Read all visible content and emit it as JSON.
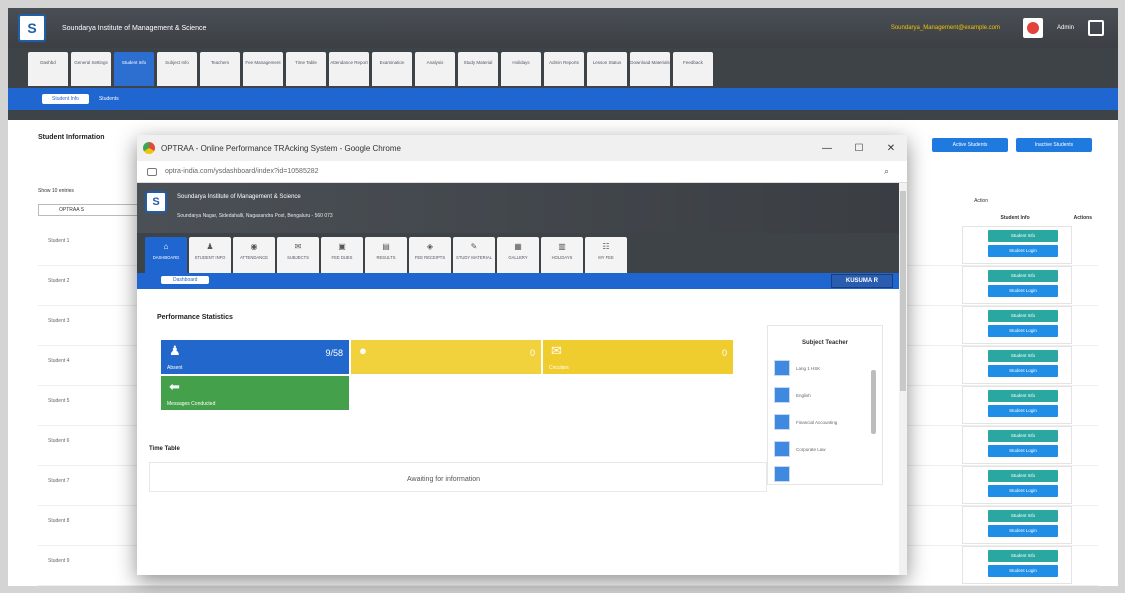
{
  "background_app": {
    "institution": "Soundarya Institute of Management & Science",
    "user_email": "Soundarya_Management@example.com",
    "user_name": "Admin",
    "tabs": [
      "Dashbd",
      "General Settings",
      "Student Info",
      "Subject Info",
      "Teachers",
      "Fee Management",
      "Time Table",
      "Attendance Report",
      "Examination",
      "Analysis",
      "Study Material",
      "Holidays",
      "Admin Reports",
      "Lesson Status",
      "Download Materials",
      "Feedback"
    ],
    "active_tab_index": 2,
    "subnav": {
      "pill": "Student Info",
      "link": "Students"
    },
    "section_title": "Student Information",
    "top_buttons": [
      "Active Students",
      "Inactive Students"
    ],
    "show_entries": "Show 10 entries",
    "filter": "OPTRAA S",
    "table_head_2": "Action",
    "col_heads": [
      "Student Info",
      "Actions"
    ],
    "rows": [
      "Student 1",
      "Student 2",
      "Student 3",
      "Student 4",
      "Student 5",
      "Student 6",
      "Student 7",
      "Student 8",
      "Student 9"
    ],
    "row_btn_top": "Student Info",
    "row_btn_bottom": "Student Login"
  },
  "window": {
    "title": "OPTRAA - Online Performance TRAcking System - Google Chrome",
    "url": "optra-india.com/ysdashboard/index?id=10585282"
  },
  "inner_app": {
    "institution": "Soundarya Institute of Management & Science",
    "address": "Soundarya Nagar, Sidedahalli, Nagasandra Post, Bengaluru - 560 073",
    "tabs": [
      {
        "icon": "⌂",
        "label": "DASHBOARD"
      },
      {
        "icon": "♟",
        "label": "STUDENT INFO"
      },
      {
        "icon": "◉",
        "label": "ATTENDANCE"
      },
      {
        "icon": "✉",
        "label": "SUBJECTS"
      },
      {
        "icon": "▣",
        "label": "FEE DUES"
      },
      {
        "icon": "▤",
        "label": "RESULTS"
      },
      {
        "icon": "◈",
        "label": "FEE RECEIPTS"
      },
      {
        "icon": "✎",
        "label": "STUDY MATERIAL"
      },
      {
        "icon": "▦",
        "label": "GALLERY"
      },
      {
        "icon": "▥",
        "label": "HOLIDAYS"
      },
      {
        "icon": "☷",
        "label": "MY FEE"
      }
    ],
    "active_tab_index": 0,
    "dashboard_pill": "Dashboard",
    "user_pill": "KUSUMA R",
    "perf_title": "Performance Statistics",
    "tiles": {
      "absent": {
        "label": "Absent",
        "value": "9/58"
      },
      "yellow_1": {
        "label": "",
        "value": "0"
      },
      "yellow_2": {
        "label": "Circulars",
        "value": "0"
      },
      "messages": {
        "label": "Messages Conducted",
        "value": ""
      }
    },
    "subject_teacher": {
      "title": "Subject Teacher",
      "items": [
        "Lang 1 HSK",
        "English",
        "Financial Accounting",
        "Corporate Law"
      ]
    },
    "time_table": {
      "title": "Time Table",
      "message": "Awaiting for information"
    }
  }
}
